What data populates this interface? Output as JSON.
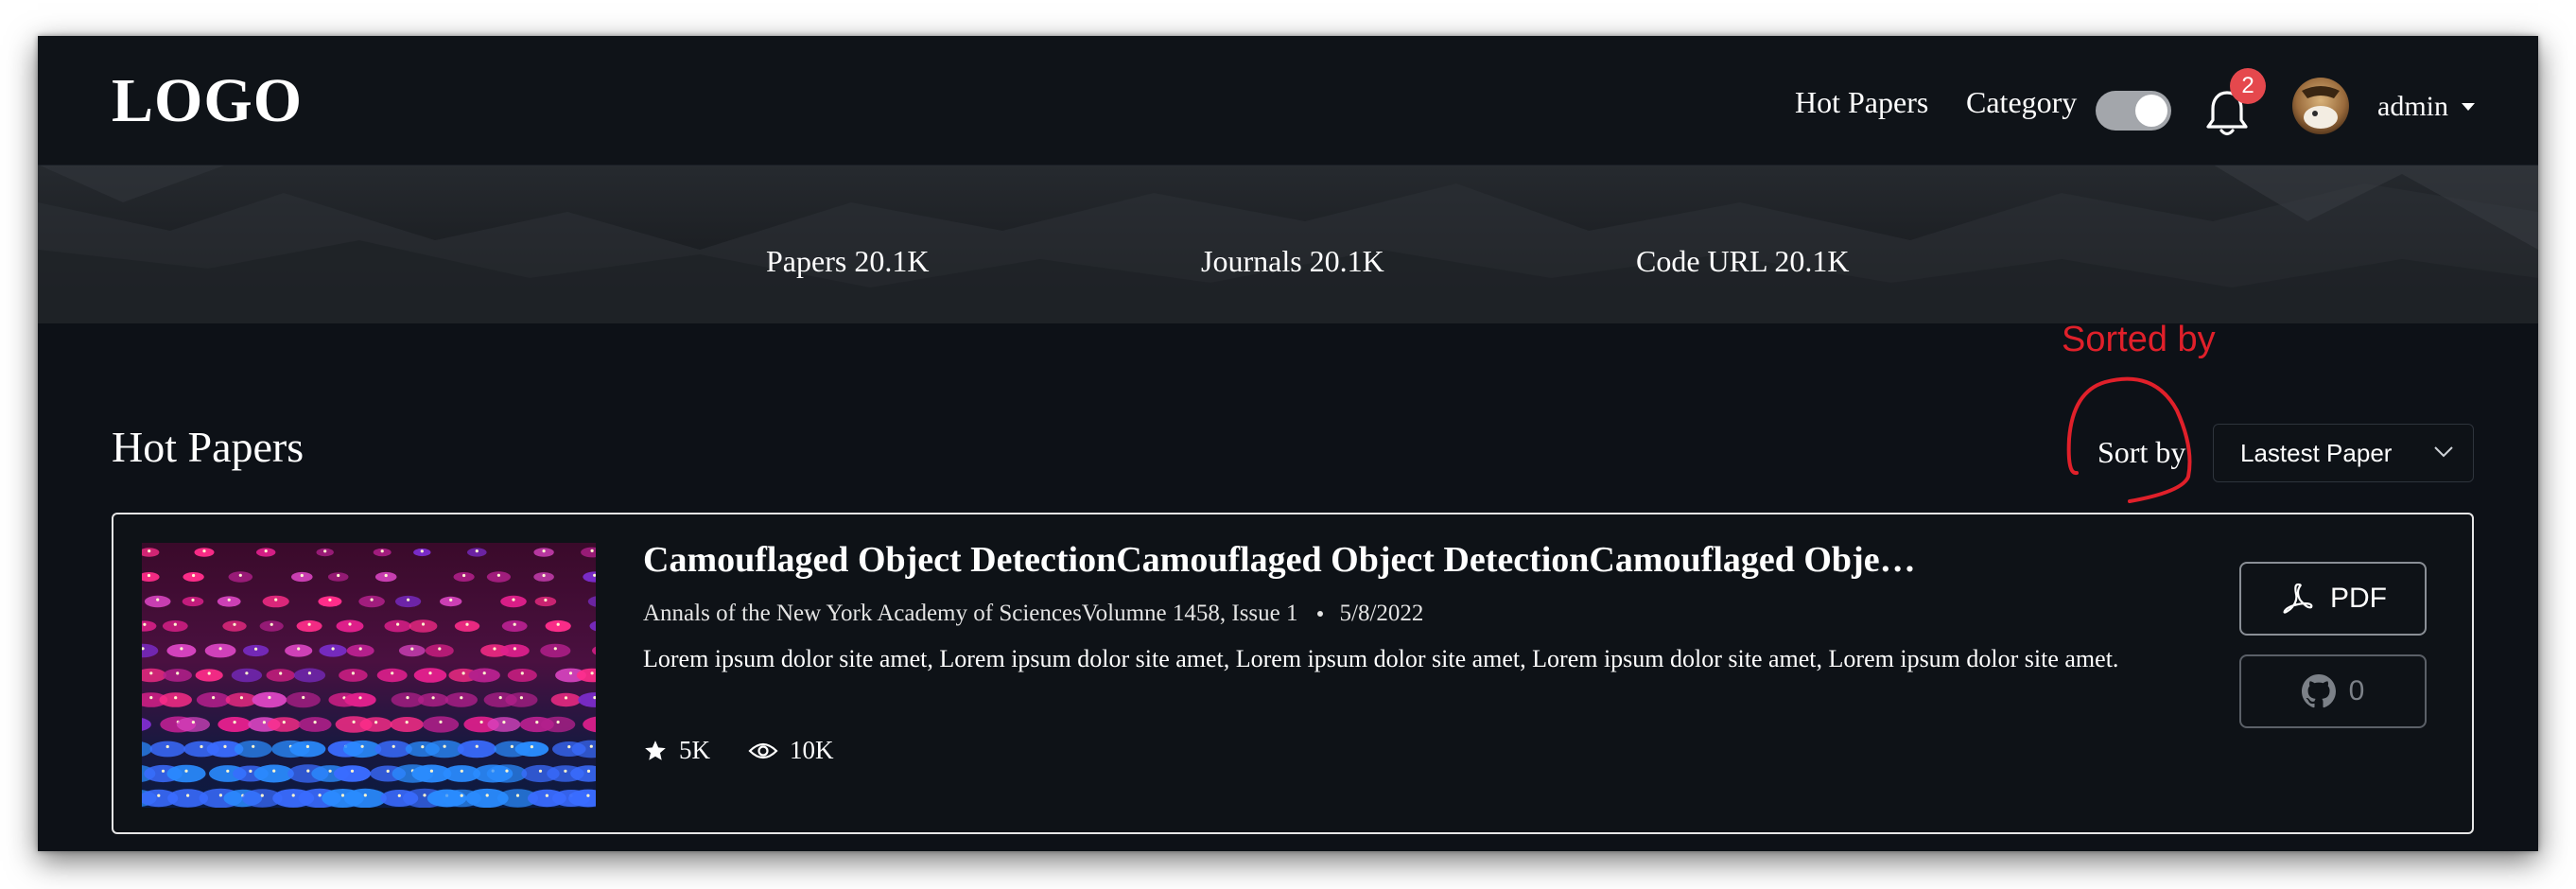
{
  "colors": {
    "accent_red": "#e0202a",
    "badge_red": "#e5484d",
    "toggle_track": "#a3a6ab",
    "background": "#0d1117"
  },
  "nav": {
    "logo": "LOGO",
    "hot_papers": "Hot Papers",
    "category": "Category",
    "category_toggle_on": true,
    "notification_count": "2",
    "username": "admin",
    "icons": {
      "bell": "bell-icon",
      "caret": "caret-down-icon"
    }
  },
  "stats": {
    "papers": "Papers 20.1K",
    "journals": "Journals 20.1K",
    "code_url": "Code URL 20.1K"
  },
  "section": {
    "title": "Hot Papers",
    "sort_label": "Sort by",
    "sort_value": "Lastest Paper",
    "annotation": "Sorted by"
  },
  "paper": {
    "title": "Camouflaged Object DetectionCamouflaged Object DetectionCamouflaged Object…",
    "journal": "Annals of the New York Academy of SciencesVolumne 1458, Issue 1",
    "date": "5/8/2022",
    "abstract": "Lorem ipsum dolor site amet, Lorem ipsum dolor site amet, Lorem ipsum dolor site amet, Lorem ipsum dolor site amet, Lorem ipsum dolor site amet.",
    "stars": "5K",
    "views": "10K",
    "pdf_label": "PDF",
    "code_count": "0",
    "icons": {
      "star": "star-icon",
      "eye": "eye-icon",
      "pdf": "pdf-icon",
      "github": "github-icon"
    }
  }
}
